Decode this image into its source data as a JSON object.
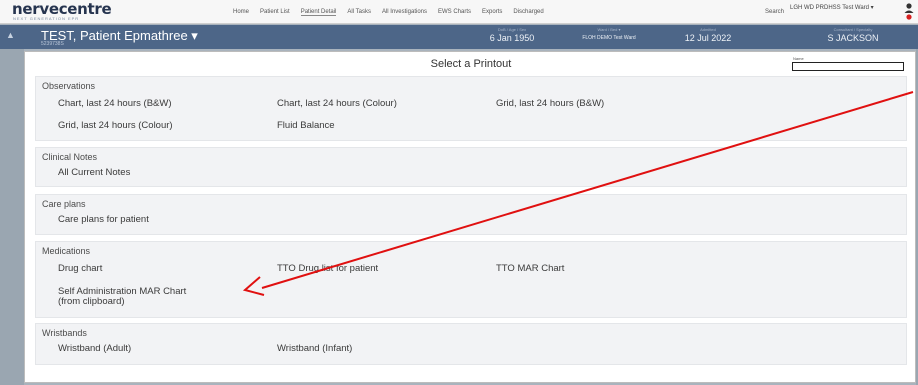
{
  "app": {
    "logo": "nervecentre",
    "logo_subtitle": "NEXT GENERATION EPR",
    "nav": [
      "Home",
      "Patient List",
      "Patient Detail",
      "All Tasks",
      "All Investigations",
      "EWS Charts",
      "Exports",
      "Discharged"
    ],
    "search_label": "Search",
    "ward_selector": "LGH WD PRDHSS Test Ward ▾",
    "user_icon": "user-alert-icon"
  },
  "patient": {
    "name": "TEST, Patient Epmathree ▾",
    "number": "5239738S",
    "dob_label": "DoB / Age / Sex",
    "dob": "6 Jan 1950",
    "ward_label": "Ward / Bed ▾",
    "ward": "FLOH DEMO Test Ward",
    "admitted_label": "Admitted",
    "admitted": "12 Jul 2022",
    "consultant_label": "Consultant / Specialty",
    "consultant": "S JACKSON"
  },
  "modal": {
    "title": "Select a Printout",
    "name_label": "Name",
    "name_value": "",
    "sections": {
      "observations": {
        "title": "Observations",
        "items": [
          "Chart, last 24 hours (B&W)",
          "Chart, last 24 hours (Colour)",
          "Grid, last 24 hours (B&W)",
          "Grid, last 24 hours (Colour)",
          "Fluid Balance"
        ]
      },
      "clinical_notes": {
        "title": "Clinical Notes",
        "items": [
          "All Current Notes"
        ]
      },
      "care_plans": {
        "title": "Care plans",
        "items": [
          "Care plans for patient"
        ]
      },
      "medications": {
        "title": "Medications",
        "items": [
          "Drug chart",
          "TTO Drug list for patient",
          "TTO MAR Chart",
          "Self Administration MAR Chart",
          "(from clipboard)"
        ]
      },
      "wristbands": {
        "title": "Wristbands",
        "items": [
          "Wristband (Adult)",
          "Wristband (Infant)"
        ]
      }
    }
  },
  "annotation": {
    "arrow_color": "#e01010"
  },
  "colors": {
    "banner": "#4d6688",
    "section_bg": "#f2f3f5"
  }
}
